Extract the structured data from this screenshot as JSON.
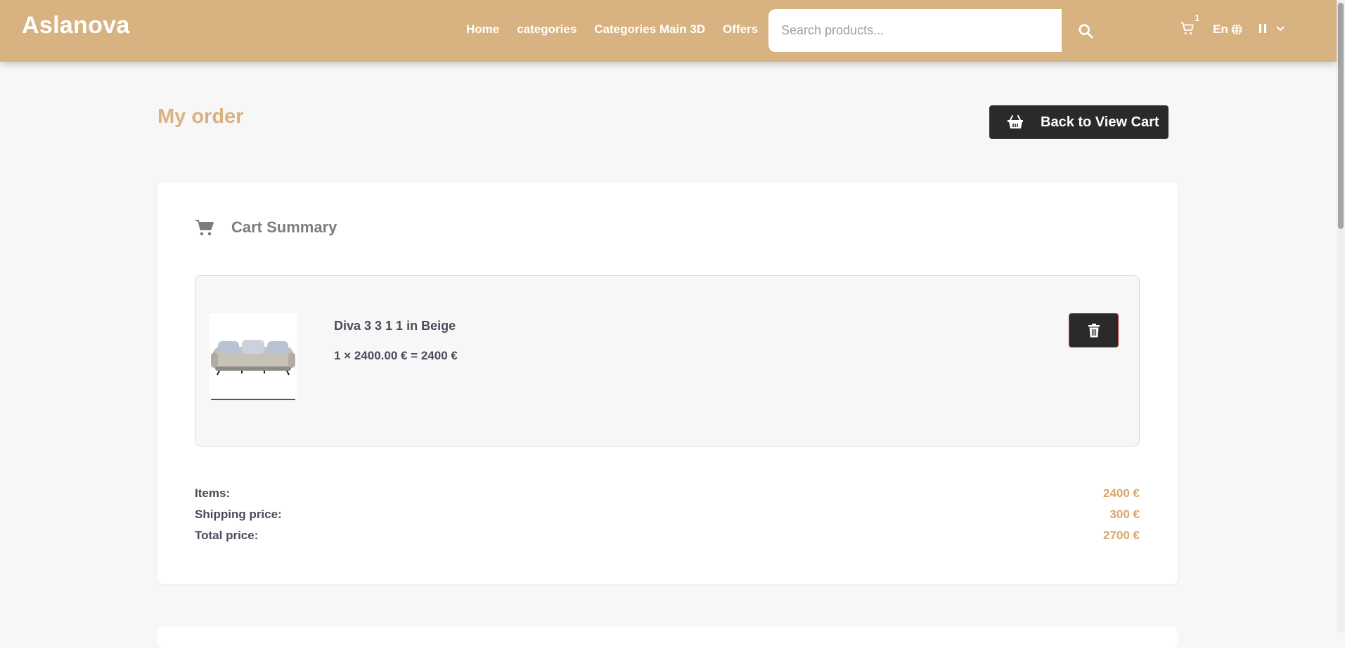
{
  "header": {
    "brand": "Aslanova",
    "nav": [
      "Home",
      "categories",
      "Categories Main 3D",
      "Offers"
    ],
    "search_placeholder": "Search products...",
    "cart_count": "1",
    "language": "En"
  },
  "page": {
    "title": "My order",
    "back_button": "Back to View Cart"
  },
  "cart_summary": {
    "title": "Cart Summary",
    "items": [
      {
        "name": "Diva 3 3 1 1 in Beige",
        "price_line": "1 × 2400.00 € = 2400 €"
      }
    ],
    "totals": [
      {
        "label": "Items:",
        "value": "2400 €"
      },
      {
        "label": "Shipping price:",
        "value": "300 €"
      },
      {
        "label": "Total price:",
        "value": "2700 €"
      }
    ]
  },
  "colors": {
    "header_bg": "#d9b282",
    "accent": "#d9a56a",
    "dark_button": "#2a2a2a",
    "delete_border": "#c0392b"
  },
  "icons": [
    "search-icon",
    "cart-icon",
    "globe-icon",
    "menu-icon",
    "chevron-down-icon",
    "basket-icon",
    "shopping-cart-icon",
    "trash-icon"
  ]
}
